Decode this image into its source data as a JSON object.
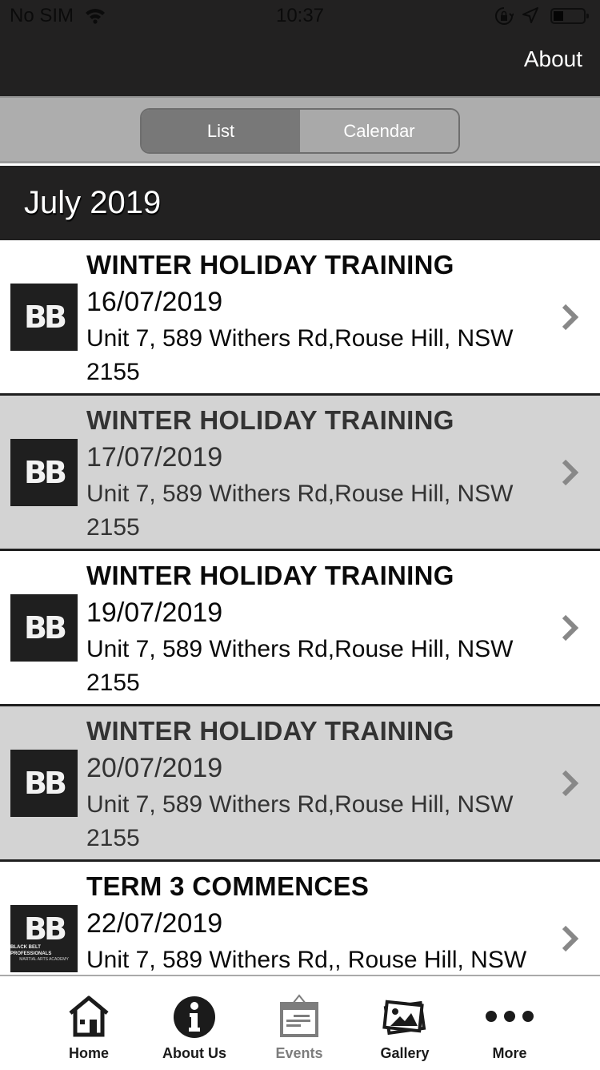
{
  "status_bar": {
    "carrier": "No SIM",
    "time": "10:37",
    "icons": [
      "wifi-icon",
      "orientation-lock-icon",
      "location-arrow-icon",
      "battery-icon"
    ]
  },
  "nav_bar": {
    "about_label": "About"
  },
  "segmented_control": {
    "options": [
      "List",
      "Calendar"
    ],
    "selected": "List"
  },
  "month_header": {
    "title": "July 2019"
  },
  "logo": {
    "mark": "BB",
    "line1": "BLACK BELT PROFESSIONALS",
    "line2": "MARTIAL ARTS ACADEMY"
  },
  "events": [
    {
      "title": "WINTER HOLIDAY TRAINING",
      "date": "16/07/2019",
      "address": "Unit 7, 589 Withers Rd,Rouse Hill, NSW 2155",
      "shade": "white"
    },
    {
      "title": "WINTER HOLIDAY TRAINING",
      "date": "17/07/2019",
      "address": "Unit 7, 589 Withers Rd,Rouse Hill, NSW 2155",
      "shade": "grey"
    },
    {
      "title": "WINTER HOLIDAY TRAINING",
      "date": "19/07/2019",
      "address": "Unit 7, 589 Withers Rd,Rouse Hill, NSW 2155",
      "shade": "white"
    },
    {
      "title": "WINTER HOLIDAY TRAINING",
      "date": "20/07/2019",
      "address": "Unit 7, 589 Withers Rd,Rouse Hill, NSW 2155",
      "shade": "grey"
    },
    {
      "title": "TERM 3 COMMENCES",
      "date": "22/07/2019",
      "address": "Unit 7, 589 Withers Rd,, Rouse Hill, NSW",
      "shade": "white"
    }
  ],
  "tab_bar": {
    "tabs": [
      {
        "label": "Home",
        "icon": "home-icon"
      },
      {
        "label": "About Us",
        "icon": "info-icon"
      },
      {
        "label": "Events",
        "icon": "calendar-icon",
        "active": true
      },
      {
        "label": "Gallery",
        "icon": "gallery-icon"
      },
      {
        "label": "More",
        "icon": "more-icon"
      }
    ]
  },
  "colors": {
    "bar_dark": "#222121",
    "segment_bg": "#adadad",
    "segment_active": "#787878",
    "row_grey": "#d3d3d3",
    "chevron": "#888888",
    "tab_active": "#7d7d7d"
  }
}
